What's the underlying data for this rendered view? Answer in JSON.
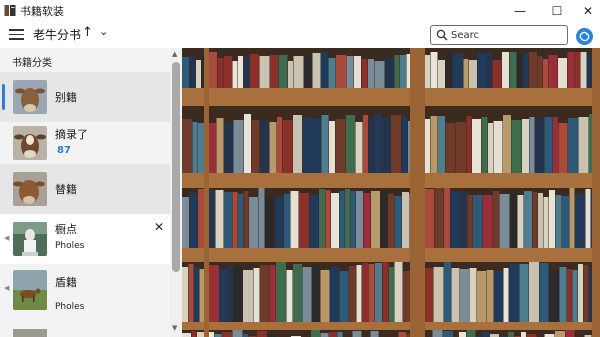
{
  "window": {
    "title": "书籍软装",
    "minimize": "—",
    "maximize": "☐",
    "close": "✕"
  },
  "toolbar": {
    "title": "老牛分书",
    "sort_arrow": "↑",
    "dropdown": "⌄"
  },
  "search": {
    "placeholder": "Searc",
    "value": ""
  },
  "sidebar": {
    "header": "书籍分类",
    "items": [
      {
        "label": "别籍",
        "sub": "",
        "count": ""
      },
      {
        "label": "摘录了",
        "sub": "",
        "count": "87"
      },
      {
        "label": "替籍",
        "sub": "",
        "count": ""
      },
      {
        "label": "橱点",
        "sub": "Pholes",
        "count": ""
      },
      {
        "label": "盾籍",
        "sub": "Pholes",
        "count": ""
      }
    ]
  },
  "icons": {
    "app": "book-icon",
    "menu": "hamburger-icon",
    "search": "search-icon",
    "sync": "sync-icon",
    "close": "close-icon"
  },
  "colors": {
    "accent": "#2a83d8",
    "sidebar_bg": "#f3f3f3",
    "shelf_wood": "#a8703c"
  }
}
